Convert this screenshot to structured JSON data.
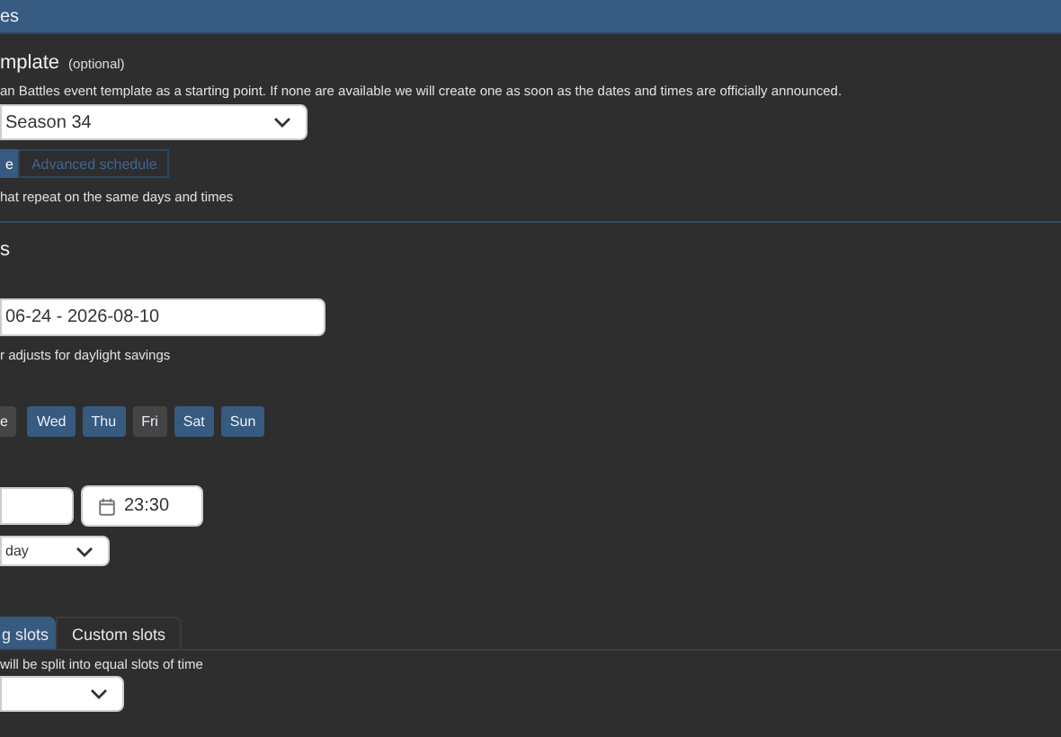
{
  "header": {
    "title": "es"
  },
  "template": {
    "title": "mplate",
    "optional": "(optional)",
    "description": "an Battles event template as a starting point. If none are available we will create one as soon as the dates and times are officially announced.",
    "select": {
      "value": "Season 34"
    },
    "modes": [
      {
        "label": "e",
        "selected": true
      },
      {
        "label": "Advanced schedule",
        "selected": false
      }
    ],
    "mode_hint": "hat repeat on the same days and times"
  },
  "dates": {
    "title": "s",
    "range": {
      "value": "06-24 - 2026-08-10"
    },
    "hint": "r adjusts for daylight savings",
    "days": [
      {
        "label": "e",
        "selected": false
      },
      {
        "label": "Wed",
        "selected": true
      },
      {
        "label": "Thu",
        "selected": true
      },
      {
        "label": "Fri",
        "selected": false
      },
      {
        "label": "Sat",
        "selected": true
      },
      {
        "label": "Sun",
        "selected": true
      }
    ],
    "end_time": {
      "value": "23:30"
    },
    "repeat": {
      "value": "day"
    },
    "slot_tabs": [
      {
        "label": "g slots",
        "selected": true
      },
      {
        "label": "Custom slots",
        "selected": false
      }
    ],
    "slot_hint": "will be split into equal slots of time"
  }
}
